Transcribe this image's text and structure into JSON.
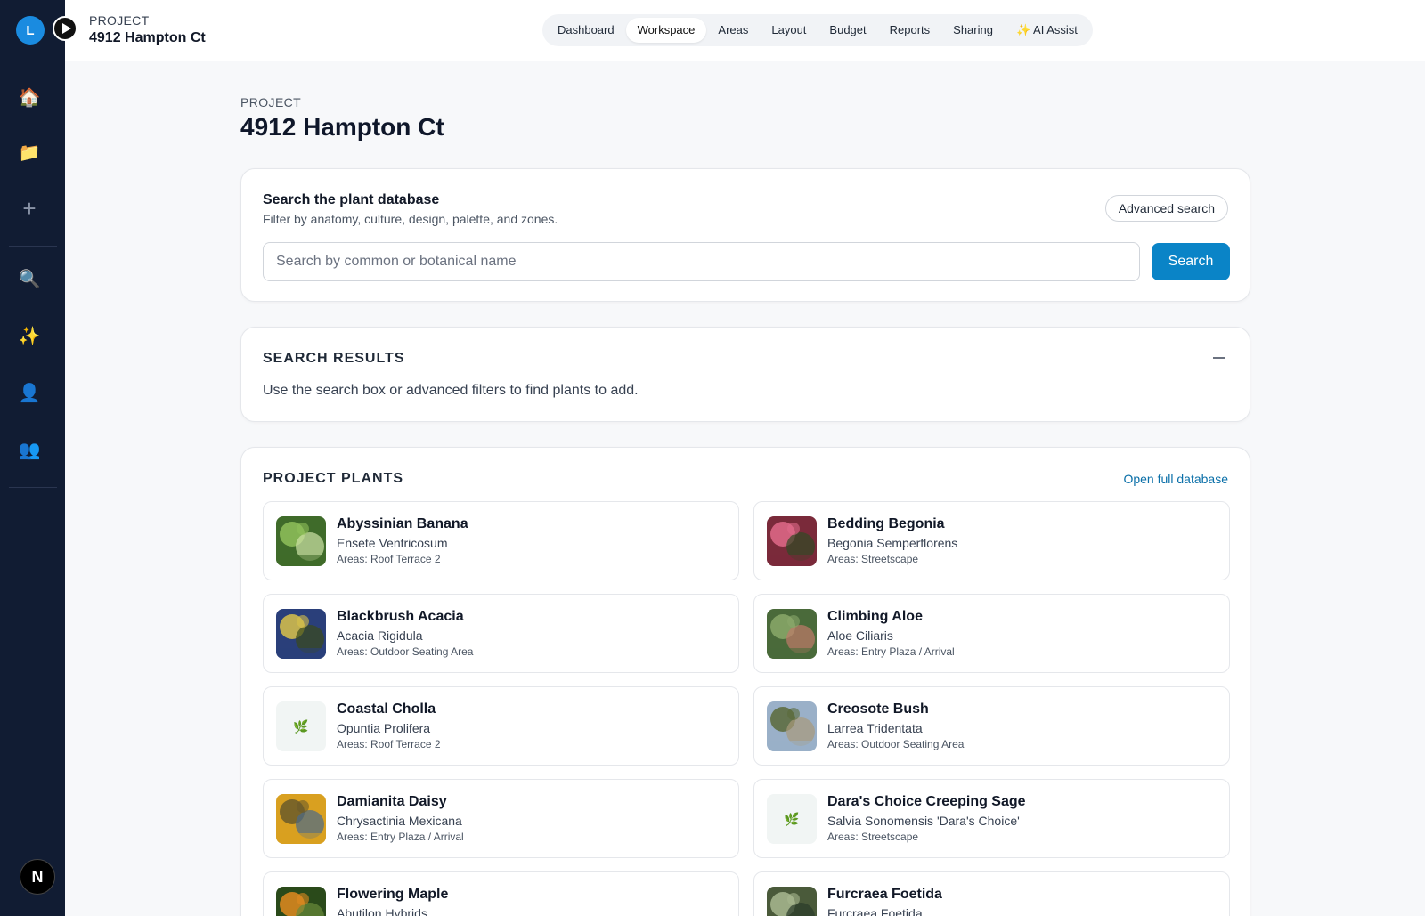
{
  "sidebar": {
    "logo_letter": "L",
    "items": [
      {
        "name": "home-icon",
        "glyph": "🏠"
      },
      {
        "name": "folder-icon",
        "glyph": "📁"
      },
      {
        "name": "add-icon",
        "glyph": "+"
      },
      {
        "name": "search-icon",
        "glyph": "🔍"
      },
      {
        "name": "sparkle-icon",
        "glyph": "✨"
      },
      {
        "name": "user-icon",
        "glyph": "👤"
      },
      {
        "name": "team-icon",
        "glyph": "👥"
      }
    ],
    "bottom_badge": "N"
  },
  "header": {
    "kicker": "PROJECT",
    "title": "4912 Hampton Ct",
    "nav": [
      "Dashboard",
      "Workspace",
      "Areas",
      "Layout",
      "Budget",
      "Reports",
      "Sharing",
      "✨ AI Assist"
    ],
    "active_nav": "Workspace"
  },
  "page": {
    "kicker": "PROJECT",
    "title": "4912 Hampton Ct"
  },
  "search": {
    "title": "Search the plant database",
    "subtitle": "Filter by anatomy, culture, design, palette, and zones.",
    "advanced_label": "Advanced search",
    "placeholder": "Search by common or botanical name",
    "value": "",
    "button_label": "Search"
  },
  "results": {
    "title": "SEARCH RESULTS",
    "message": "Use the search box or advanced filters to find plants to add.",
    "collapse_glyph": "—"
  },
  "plants": {
    "title": "PROJECT PLANTS",
    "open_db_label": "Open full database",
    "items": [
      {
        "name": "Abyssinian Banana",
        "botanical": "Ensete Ventricosum",
        "areas": "Areas: Roof Terrace 2",
        "thumb": "photo",
        "colors": [
          "#3f6b2a",
          "#8fbf5a",
          "#cfe3a6"
        ]
      },
      {
        "name": "Bedding Begonia",
        "botanical": "Begonia Semperflorens",
        "areas": "Areas: Streetscape",
        "thumb": "photo",
        "colors": [
          "#7a2a3a",
          "#e06a8a",
          "#2f4a24"
        ]
      },
      {
        "name": "Blackbrush Acacia",
        "botanical": "Acacia Rigidula",
        "areas": "Areas: Outdoor Seating Area",
        "thumb": "photo",
        "colors": [
          "#2a3f7a",
          "#d9c24a",
          "#3a4a1a"
        ]
      },
      {
        "name": "Climbing Aloe",
        "botanical": "Aloe Ciliaris",
        "areas": "Areas: Entry Plaza / Arrival",
        "thumb": "photo",
        "colors": [
          "#4a6a3a",
          "#8aa86a",
          "#c07a6a"
        ]
      },
      {
        "name": "Coastal Cholla",
        "botanical": "Opuntia Prolifera",
        "areas": "Areas: Roof Terrace 2",
        "thumb": "placeholder",
        "glyph": "🌿"
      },
      {
        "name": "Creosote Bush",
        "botanical": "Larrea Tridentata",
        "areas": "Areas: Outdoor Seating Area",
        "thumb": "photo",
        "colors": [
          "#9ab0c8",
          "#5a6a3a",
          "#a89a7a"
        ]
      },
      {
        "name": "Damianita Daisy",
        "botanical": "Chrysactinia Mexicana",
        "areas": "Areas: Entry Plaza / Arrival",
        "thumb": "photo",
        "colors": [
          "#d9a020",
          "#6a5a2a",
          "#4a6a8a"
        ]
      },
      {
        "name": "Dara's Choice Creeping Sage",
        "botanical": "Salvia Sonomensis 'Dara's Choice'",
        "areas": "Areas: Streetscape",
        "thumb": "placeholder",
        "glyph": "🌿"
      },
      {
        "name": "Flowering Maple",
        "botanical": "Abutilon Hybrids",
        "areas": "",
        "thumb": "photo",
        "colors": [
          "#2a4a1a",
          "#e08a20",
          "#6a8a3a"
        ]
      },
      {
        "name": "Furcraea Foetida",
        "botanical": "Furcraea Foetida",
        "areas": "",
        "thumb": "photo",
        "colors": [
          "#4a5a3a",
          "#a8b890",
          "#2a3a2a"
        ]
      }
    ]
  }
}
